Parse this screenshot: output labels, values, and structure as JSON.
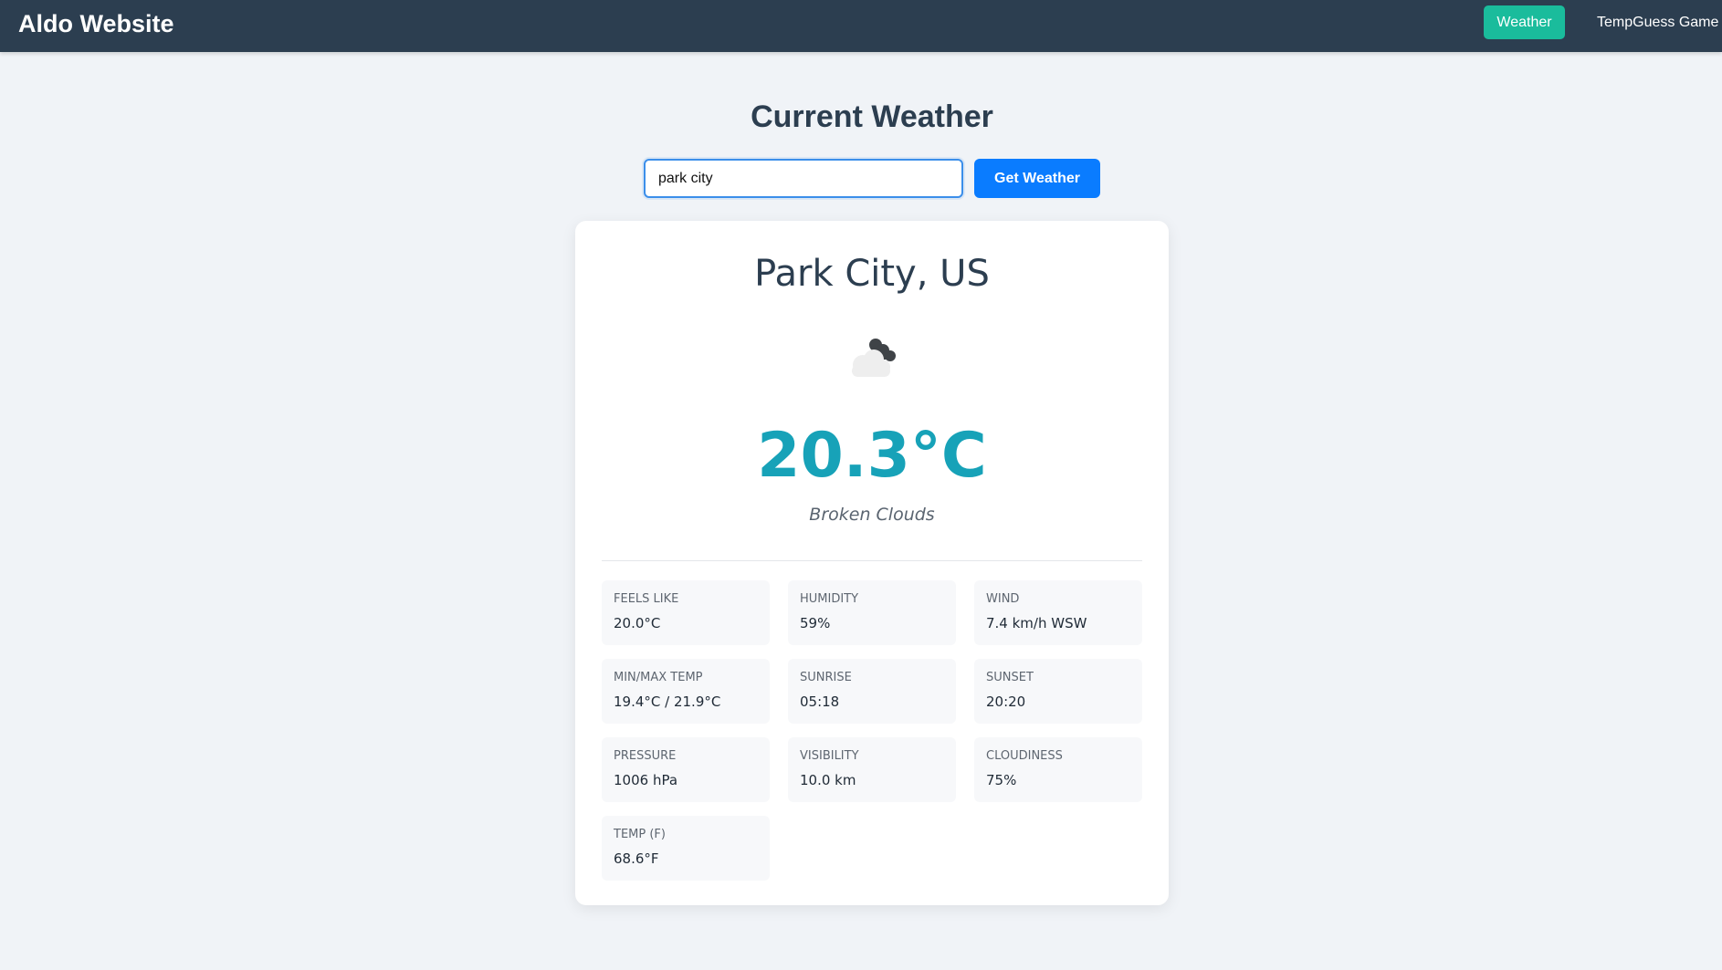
{
  "navbar": {
    "brand": "Aldo Website",
    "links": [
      {
        "label": "Weather",
        "active": true
      },
      {
        "label": "TempGuess Game",
        "active": false
      }
    ],
    "background": "#2c3e50",
    "active_color": "#1abc9c"
  },
  "main": {
    "title": "Current Weather",
    "search": {
      "value": "park city",
      "button_label": "Get Weather"
    }
  },
  "weather": {
    "location": "Park City, US",
    "icon": "broken-clouds-icon",
    "temperature": "20.3°C",
    "description": "Broken Clouds",
    "details": [
      {
        "label": "FEELS LIKE",
        "value": "20.0°C"
      },
      {
        "label": "HUMIDITY",
        "value": "59%"
      },
      {
        "label": "WIND",
        "value": "7.4 km/h WSW"
      },
      {
        "label": "MIN/MAX TEMP",
        "value": "19.4°C / 21.9°C"
      },
      {
        "label": "SUNRISE",
        "value": "05:18"
      },
      {
        "label": "SUNSET",
        "value": "20:20"
      },
      {
        "label": "PRESSURE",
        "value": "1006 hPa"
      },
      {
        "label": "VISIBILITY",
        "value": "10.0 km"
      },
      {
        "label": "CLOUDINESS",
        "value": "75%"
      },
      {
        "label": "TEMP (F)",
        "value": "68.6°F"
      }
    ],
    "accent_color": "#17a2b8"
  }
}
